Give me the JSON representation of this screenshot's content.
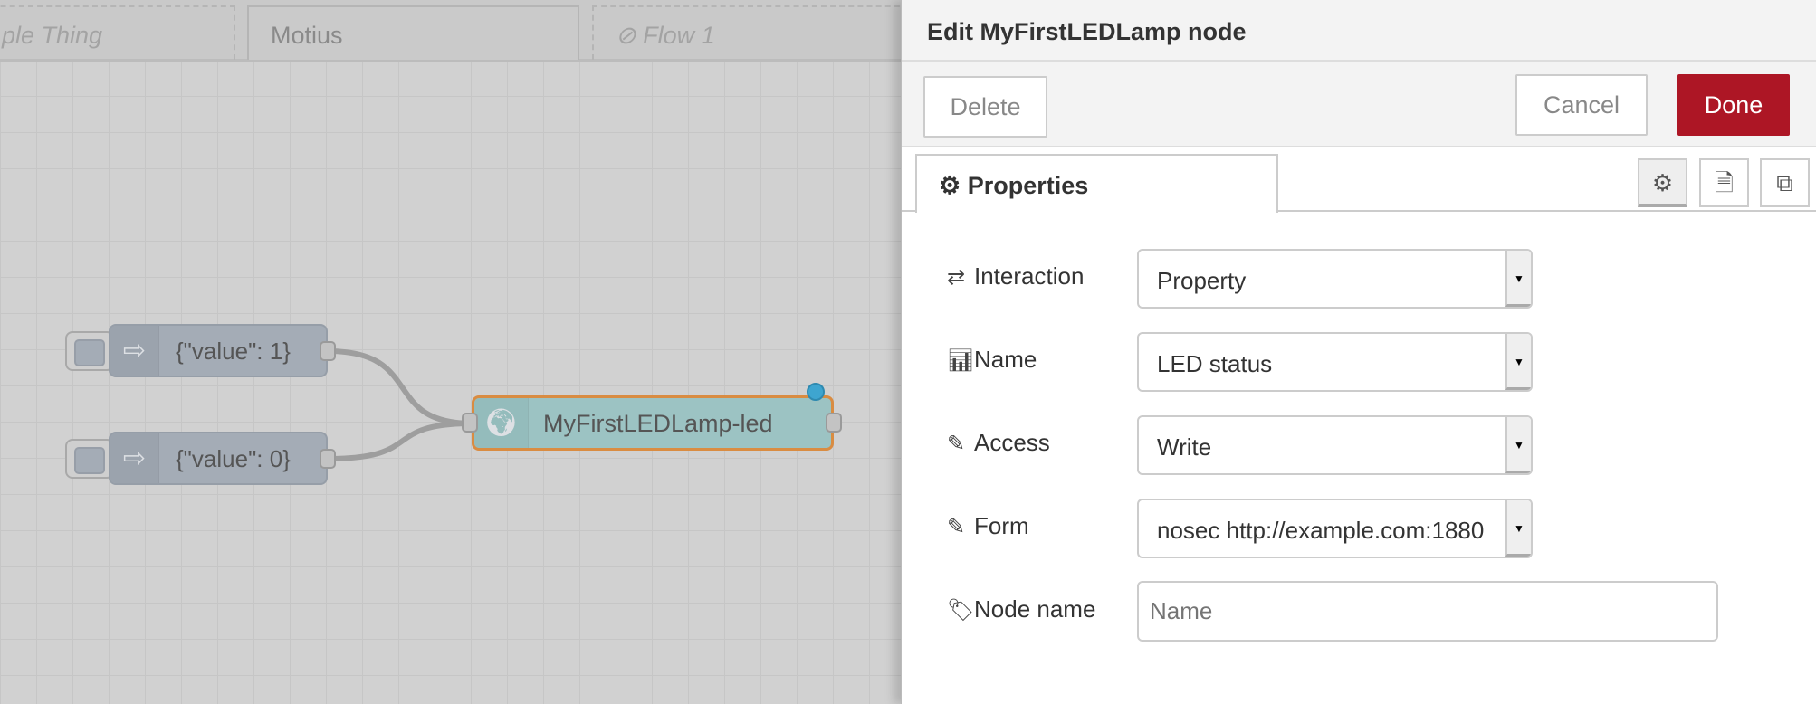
{
  "flow_tabs": [
    {
      "label": "ple Thing",
      "disabled": true
    },
    {
      "label": "Motius",
      "active": true
    },
    {
      "label": "Flow 1",
      "disabled": true,
      "icon": "disabled-icon"
    }
  ],
  "nodes": {
    "inject1": {
      "label": "{\"value\": 1}",
      "icon": "arrow-right-icon"
    },
    "inject2": {
      "label": "{\"value\": 0}",
      "icon": "arrow-right-icon"
    },
    "led": {
      "label": "MyFirstLEDLamp-led",
      "icon": "globe-icon",
      "color": "#9cc3c3",
      "selected_border": "#d98c42",
      "changed_dot": "#3ea5d0"
    }
  },
  "panel": {
    "title": "Edit MyFirstLEDLamp node",
    "delete_label": "Delete",
    "cancel_label": "Cancel",
    "done_label": "Done",
    "done_color": "#ad1625",
    "tab_label": "Properties",
    "fields": [
      {
        "label": "Interaction",
        "icon": "arrows-exchange-icon",
        "value": "Property"
      },
      {
        "label": "Name",
        "icon": "bar-chart-icon",
        "value": "LED status"
      },
      {
        "label": "Access",
        "icon": "pencil-icon",
        "value": "Write"
      },
      {
        "label": "Form",
        "icon": "pencil-icon",
        "value": "nosec http://example.com:1880"
      }
    ],
    "node_name": {
      "label": "Node name",
      "icon": "tag-icon",
      "value": "",
      "placeholder": "Name"
    }
  }
}
